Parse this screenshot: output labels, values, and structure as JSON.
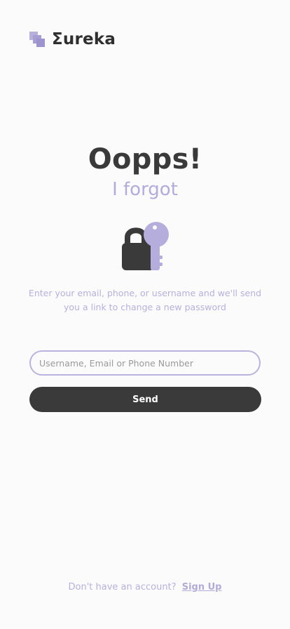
{
  "header": {
    "logo_icon": "layered-squares-icon",
    "app_name": "Ʃureka"
  },
  "main": {
    "title": "Oopps!",
    "subtitle": "I forgot",
    "illustration_icon": "lock-and-key-icon",
    "description": "Enter your email, phone, or username and we'll send you a link to change a new password"
  },
  "form": {
    "identifier_placeholder": "Username, Email or Phone Number",
    "identifier_value": "",
    "send_label": "Send"
  },
  "footer": {
    "prompt": "Don't have an account?",
    "signup_label": "Sign Up"
  },
  "colors": {
    "accent": "#b5addc",
    "dark": "#3a3a3a",
    "background": "#fbfbfb"
  }
}
